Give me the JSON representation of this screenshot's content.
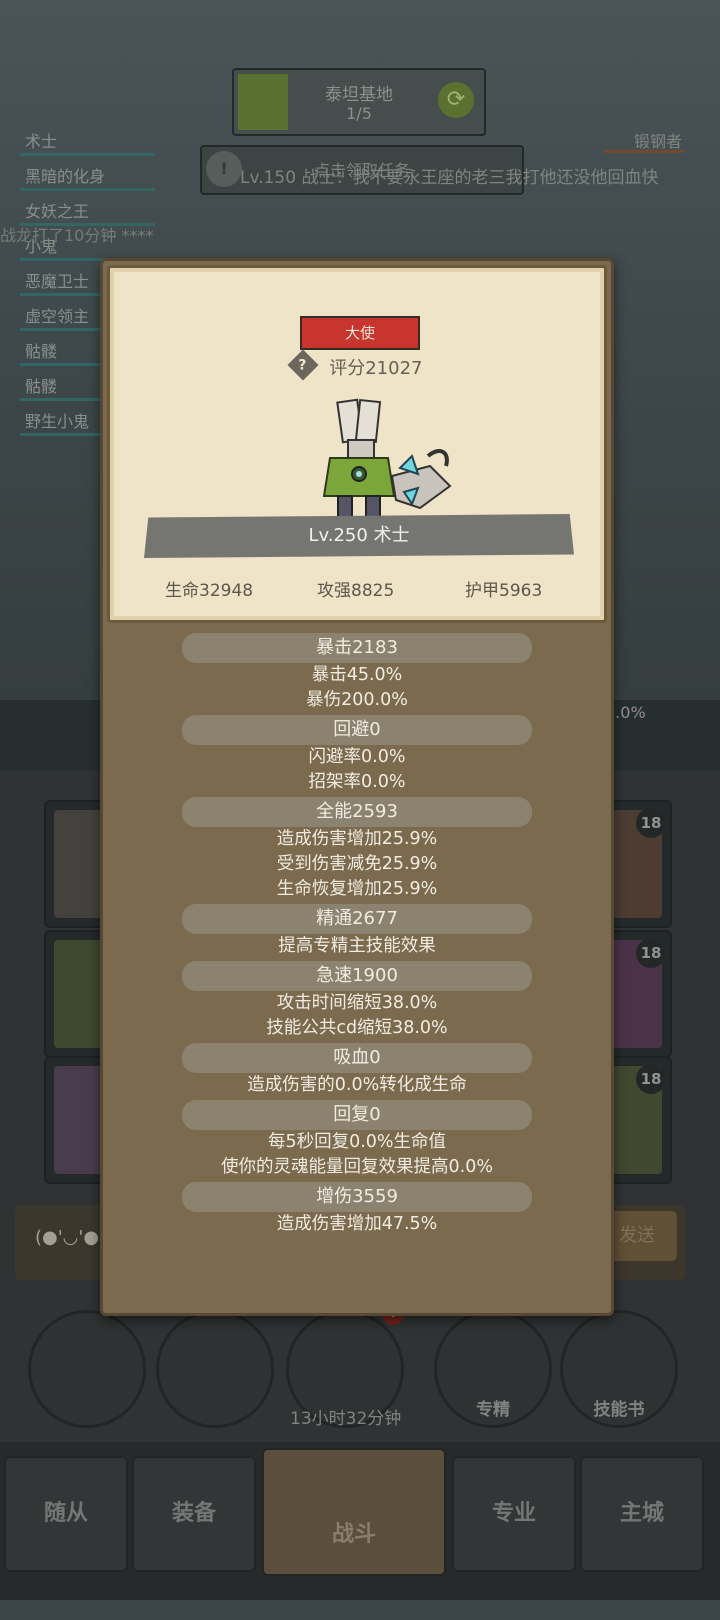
{
  "background": {
    "title": "泰坦基地",
    "progress": "1/5",
    "quest_button": "点击领取任务",
    "chat_message": "Lv.150 战士：我不要永王座的老三我打他还没他回血快",
    "left_ghost_text": "战龙打了10分钟 ****",
    "right_name": "锻钢者",
    "left_list": [
      "术士",
      "黑暗的化身",
      "女妖之王",
      "小鬼",
      "恶魔卫士",
      "虚空领主",
      "骷髅",
      "骷髅",
      "野生小鬼"
    ],
    "right_pct": "0.0%",
    "slot_level": "18",
    "chat_face": "(●'◡'●",
    "send_label": "发送",
    "bag_badge": "!",
    "circle_buttons": [
      "",
      "",
      "",
      "专精",
      "技能书"
    ],
    "timer": "13小时32分钟",
    "nav_tabs": [
      "随从",
      "装备",
      "战斗",
      "专业",
      "主城"
    ]
  },
  "card": {
    "role": "大使",
    "score": "评分21027",
    "level_name": "Lv.250 术士",
    "hp": "生命32948",
    "attack": "攻强8825",
    "armor": "护甲5963"
  },
  "details": [
    {
      "header": "暴击2183",
      "lines": [
        "暴击45.0%",
        "暴伤200.0%"
      ]
    },
    {
      "header": "回避0",
      "lines": [
        "闪避率0.0%",
        "招架率0.0%"
      ]
    },
    {
      "header": "全能2593",
      "lines": [
        "造成伤害增加25.9%",
        "受到伤害减免25.9%",
        "生命恢复增加25.9%"
      ]
    },
    {
      "header": "精通2677",
      "lines": [
        "提高专精主技能效果"
      ]
    },
    {
      "header": "急速1900",
      "lines": [
        "攻击时间缩短38.0%",
        "技能公共cd缩短38.0%"
      ]
    },
    {
      "header": "吸血0",
      "lines": [
        "造成伤害的0.0%转化成生命"
      ]
    },
    {
      "header": "回复0",
      "lines": [
        "每5秒回复0.0%生命值",
        "使你的灵魂能量回复效果提高0.0%"
      ]
    },
    {
      "header": "增伤3559",
      "lines": [
        "造成伤害增加47.5%"
      ]
    }
  ]
}
